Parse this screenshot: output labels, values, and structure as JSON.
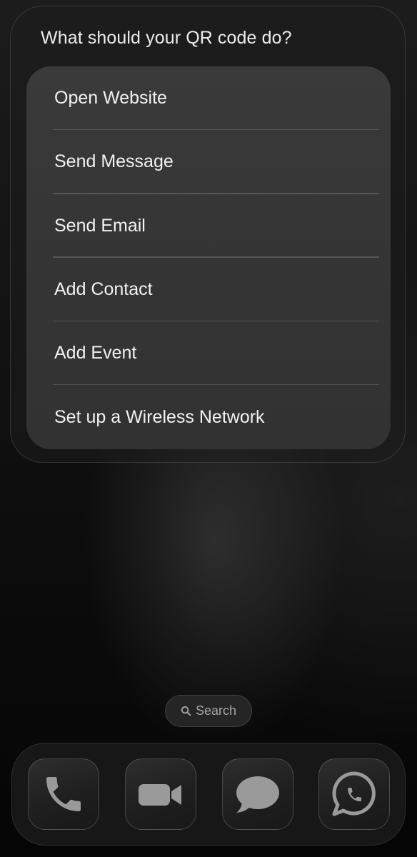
{
  "widget": {
    "title": "What should your QR code do?",
    "options": [
      {
        "label": "Open Website"
      },
      {
        "label": "Send Message"
      },
      {
        "label": "Send Email"
      },
      {
        "label": "Add Contact"
      },
      {
        "label": "Add Event"
      },
      {
        "label": "Set up a Wireless Network"
      }
    ]
  },
  "search": {
    "label": "Search",
    "icon": "magnifying-glass"
  },
  "dock": {
    "apps": [
      {
        "icon": "phone-icon"
      },
      {
        "icon": "facetime-video-icon"
      },
      {
        "icon": "messages-bubble-icon"
      },
      {
        "icon": "whatsapp-icon"
      }
    ]
  },
  "colors": {
    "background": "#000000",
    "menu_background": "#363636",
    "text": "#f2f2f2",
    "icon_glyph": "#9a9a9a"
  }
}
